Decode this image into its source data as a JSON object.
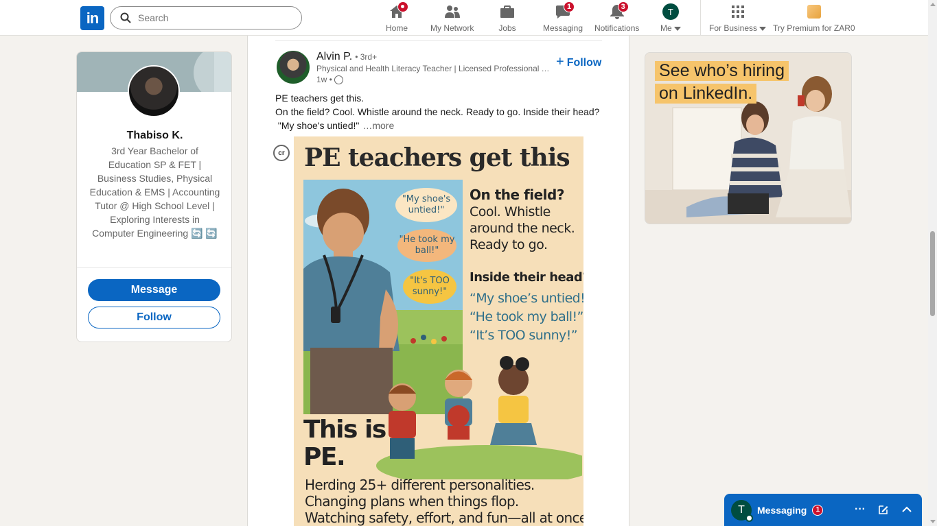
{
  "nav": {
    "search_placeholder": "Search",
    "home": "Home",
    "network": "My Network",
    "jobs": "Jobs",
    "messaging": "Messaging",
    "messaging_badge": "1",
    "notifications": "Notifications",
    "notifications_badge": "3",
    "me": "Me",
    "me_initial": "T",
    "for_business": "For Business",
    "premium": "Try Premium for ZAR0"
  },
  "profile": {
    "name": "Thabiso K.",
    "headline": "3rd Year Bachelor of Education SP & FET | Business Studies, Physical Education & EMS | Accounting Tutor @ High School Level | Exploring Interests in Computer Engineering 🔄 🔄",
    "message_label": "Message",
    "follow_label": "Follow"
  },
  "post": {
    "author": "Alvin P.",
    "degree": "• 3rd+",
    "author_title": "Physical and Health Literacy Teacher | Licensed Professional Te...",
    "time": "1w •",
    "follow_label": "Follow",
    "text_line1": "PE teachers get this.",
    "text_line2": "On the field? Cool. Whistle around the neck. Ready to go. Inside their head?",
    "text_line3": "\"My shoe's untied!\"",
    "more": "…more",
    "cr_label": "cr",
    "image": {
      "title": "PE teachers get this",
      "bubble1": "\"My shoe's untied!\"",
      "bubble2": "\"He took my ball!\"",
      "bubble3": "\"It's TOO sunny!\"",
      "on_field": "On the field?",
      "on_field_text": "Cool. Whistle around the neck. Ready to go.",
      "inside_head": "Inside their head?",
      "quote1": "“My shoe’s untied!”",
      "quote2": "“He took my ball!”",
      "quote3": "“It’s TOO sunny!”",
      "this_is": "This is",
      "pe": "PE.",
      "bottom1": "Herding 25+ different personalities.",
      "bottom2": "Changing plans when things flop.",
      "bottom3": "Watching safety, effort, and fun—all at once."
    }
  },
  "ad": {
    "line1": "See who’s hiring",
    "line2": "on LinkedIn."
  },
  "messaging_tab": {
    "initial": "T",
    "title": "Messaging",
    "badge": "1"
  },
  "colors": {
    "brand": "#0a66c2",
    "badge": "#cb112d",
    "background": "#f4f2ee"
  }
}
